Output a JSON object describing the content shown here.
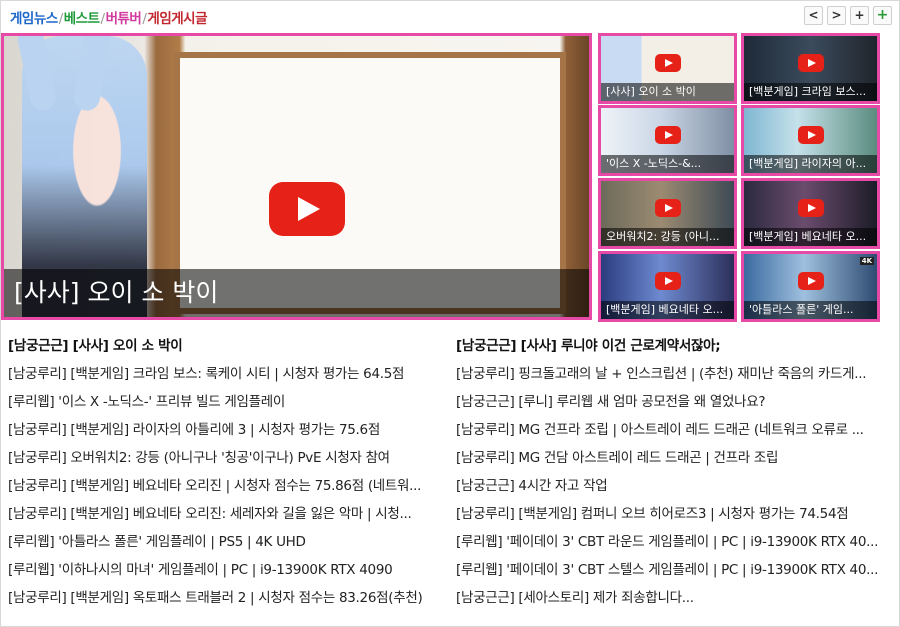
{
  "header": {
    "tabs": [
      {
        "label": "게임뉴스",
        "color": "#1a66c9"
      },
      {
        "label": "베스트",
        "color": "#1f9a3a"
      },
      {
        "label": "버튜버",
        "color": "#d0399d"
      },
      {
        "label": "게임게시글",
        "color": "#c2262e"
      }
    ],
    "separator": "/",
    "nav": {
      "prev": "<",
      "next": ">",
      "add1": "+",
      "add2": "+"
    }
  },
  "featured": {
    "title": "[사사] 오이 소 박이",
    "accent": "#e64aa6"
  },
  "thumbnails": [
    {
      "caption": "[사사] 오이 소 박이",
      "bg": "linear-gradient(90deg,#c9dbf2 0 30%, #f3efe7 31% 100%)"
    },
    {
      "caption": "[백분게임] 크라임 보스...",
      "bg": "linear-gradient(90deg,#1e2a38,#3b4b5c 50%,#20252c)"
    },
    {
      "caption": "'이스 X -노딕스-&...",
      "bg": "linear-gradient(90deg,#eef3f8,#cad6e6 45%,#7f8fa3)"
    },
    {
      "caption": "[백분게임] 라이자의 아...",
      "bg": "linear-gradient(90deg,#7fb6d2,#c5e1ea 40%,#5a8c7e)"
    },
    {
      "caption": "오버워치2: 강등 (아니...",
      "bg": "linear-gradient(90deg,#6d6a5a,#9c8b72 45%,#3d4a55)"
    },
    {
      "caption": "[백분게임] 베요네타 오...",
      "bg": "linear-gradient(90deg,#2b2a3f,#6b4c6e 45%,#1c1c28)"
    },
    {
      "caption": "[백분게임] 베요네타 오...",
      "bg": "linear-gradient(90deg,#2a3c7e,#6e8ad0 45%,#2c2f5a)"
    },
    {
      "caption": "'아틀라스 폴른' 게임...",
      "bg": "linear-gradient(90deg,#3a6aa0,#9fc0de 45%,#2e4c72)",
      "badge": "4K"
    }
  ],
  "left_list": [
    "[남궁근근] [사사] 오이 소 박이",
    "[남궁루리] [백분게임] 크라임 보스: 록케이 시티 | 시청자 평가는 64.5점",
    "[루리웹] '이스 X -노딕스-' 프리뷰 빌드 게임플레이",
    "[남궁루리] [백분게임] 라이자의 아틀리에 3 | 시청자 평가는 75.6점",
    "[남궁루리] 오버워치2: 강등 (아니구나 '칭공'이구나) PvE 시청자 참여",
    "[남궁루리] [백분게임] 베요네타 오리진 | 시청자 점수는 75.86점 (네트워...",
    "[남궁루리] [백분게임] 베요네타 오리진: 세레자와 길을 잃은 악마 | 시청...",
    "[루리웹] '아틀라스 폴른' 게임플레이 | PS5 | 4K UHD",
    "[루리웹] '이하나시의 마녀' 게임플레이 | PC | i9-13900K RTX 4090",
    "[남궁루리] [백분게임] 옥토패스 트래블러 2 | 시청자 점수는 83.26점(추천)"
  ],
  "right_list": [
    "[남궁근근] [사사] 루니야 이건 근로계약서잖아;",
    "[남궁루리] 핑크돌고래의 날 + 인스크립션 | (추천) 재미난 죽음의 카드게...",
    "[남궁근근] [루니] 루리웹 새 엄마 공모전을 왜 열었나요?",
    "[남궁루리] MG 건프라 조립 | 아스트레이 레드 드래곤 (네트워크 오류로 ...",
    "[남궁루리] MG 건담 아스트레이 레드 드래곤 | 건프라 조립",
    "[남궁근근] 4시간 자고 작업",
    "[남궁루리] [백분게임] 컴퍼니 오브 히어로즈3 | 시청자 평가는 74.54점",
    "[루리웹] '페이데이 3' CBT 라운드 게임플레이 | PC | i9-13900K RTX 40...",
    "[루리웹] '페이데이 3' CBT 스텔스 게임플레이 | PC | i9-13900K RTX 40...",
    "[남궁근근] [세아스토리] 제가 죄송합니다..."
  ]
}
